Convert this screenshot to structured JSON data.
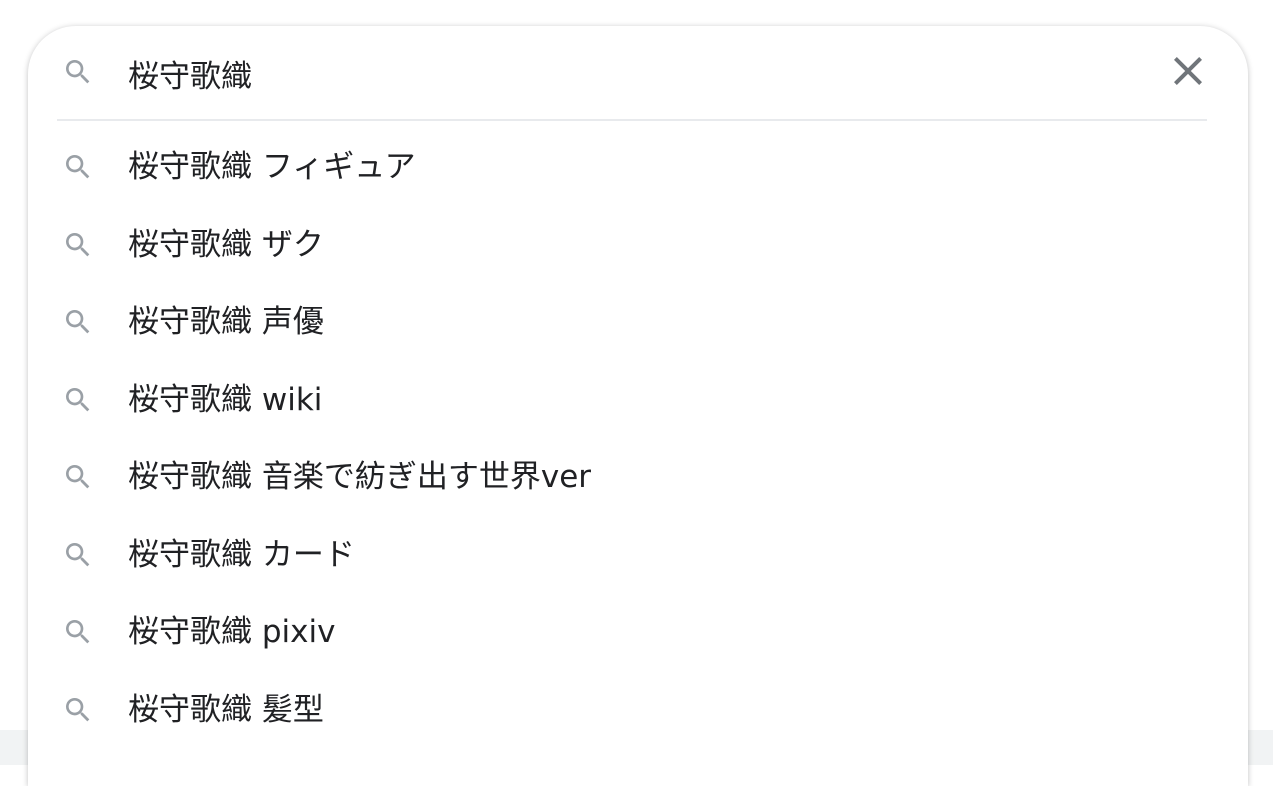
{
  "search": {
    "query": "桜守歌織",
    "icon": "search-icon",
    "clear_icon": "close-icon"
  },
  "suggestions": [
    {
      "text": "桜守歌織 フィギュア"
    },
    {
      "text": "桜守歌織 ザク"
    },
    {
      "text": "桜守歌織 声優"
    },
    {
      "text": "桜守歌織 wiki"
    },
    {
      "text": "桜守歌織 音楽で紡ぎ出す世界ver"
    },
    {
      "text": "桜守歌織 カード"
    },
    {
      "text": "桜守歌織 pixiv"
    },
    {
      "text": "桜守歌織 髪型"
    }
  ],
  "colors": {
    "text": "#202124",
    "icon": "#9aa0a6",
    "clear_icon": "#70757a",
    "divider": "#e8eaed"
  }
}
